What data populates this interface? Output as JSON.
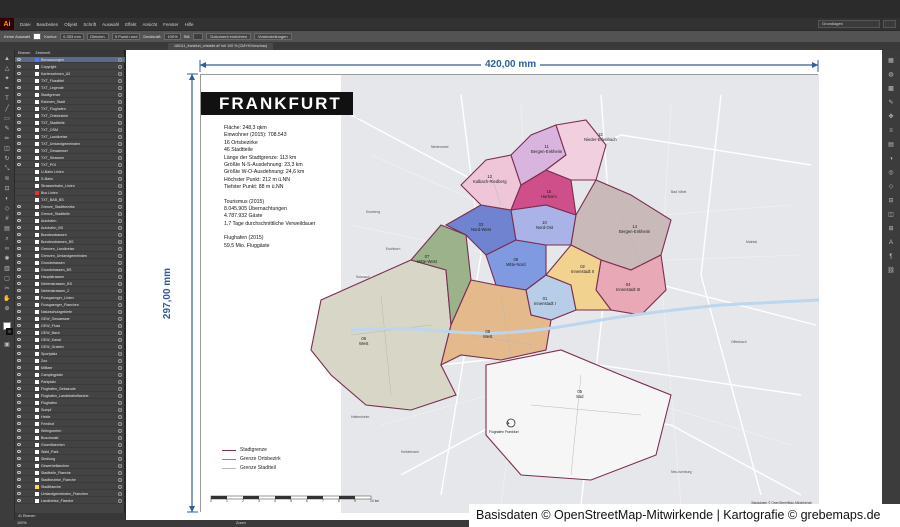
{
  "app": {
    "logo": "Ai"
  },
  "menu": [
    "Datei",
    "Bearbeiten",
    "Objekt",
    "Schrift",
    "Auswahl",
    "Effekt",
    "Ansicht",
    "Fenster",
    "Hilfe"
  ],
  "workspace": "Grundlagen",
  "controlbar": {
    "selection": "Keine Auswahl",
    "stroke_label": "Kontur:",
    "stroke_value": "0,353 mm",
    "profile": "Gleichm.",
    "brush": "5 Punkt rund",
    "opacity_label": "Deckkraft:",
    "opacity_value": "100%",
    "style_label": "Stil:",
    "doc_setup": "Dokument einrichten",
    "preferences": "Voreinstellungen"
  },
  "doc_tab": "180111_frankfurt_ortsteile.ai* bei 100 % (CMYK/Vorschau)",
  "layers": {
    "tabs": [
      "Ebenen",
      "Zeichenfl."
    ],
    "footer": "41 Ebenen",
    "rows": [
      {
        "name": "Bemassungen",
        "color": "#4f7cff",
        "eye": true,
        "selected": true
      },
      {
        "name": "Copyright",
        "color": "#ffffff",
        "eye": true
      },
      {
        "name": "Kartenrahmen_A3",
        "color": "#ffffff",
        "eye": true
      },
      {
        "name": "TXT_Flusstitel",
        "color": "#ffffff",
        "eye": true
      },
      {
        "name": "TXT_Legende",
        "color": "#ffffff",
        "eye": true
      },
      {
        "name": "Stadtgrenze",
        "color": "#ffffff",
        "eye": true
      },
      {
        "name": "Rahmen_Stadt",
        "color": "#ffffff",
        "eye": true
      },
      {
        "name": "TXT_Flughafen",
        "color": "#ffffff",
        "eye": true
      },
      {
        "name": "TXT_Ortsbezirke",
        "color": "#ffffff",
        "eye": true
      },
      {
        "name": "TXT_Stadtteile",
        "color": "#ffffff",
        "eye": true
      },
      {
        "name": "TXT_OSM",
        "color": "#ffffff",
        "eye": true
      },
      {
        "name": "TXT_Landkreise",
        "color": "#ffffff",
        "eye": true
      },
      {
        "name": "TXT_Umlandgemeinden",
        "color": "#ffffff",
        "eye": true
      },
      {
        "name": "TXT_Gewaesser",
        "color": "#ffffff",
        "eye": true
      },
      {
        "name": "TXT_Strassen",
        "color": "#ffffff",
        "eye": true
      },
      {
        "name": "TXT_POI",
        "color": "#ffffff",
        "eye": true
      },
      {
        "name": "U-Bahn Linien",
        "color": "#ffffff",
        "eye": false
      },
      {
        "name": "S-Bahn",
        "color": "#ffffff",
        "eye": false
      },
      {
        "name": "Strassenbahn_Linien",
        "color": "#ffffff",
        "eye": false
      },
      {
        "name": "Bus Linien",
        "color": "#e8342b",
        "eye": false
      },
      {
        "name": "TXT_BAB_BS",
        "color": "#ffffff",
        "eye": false
      },
      {
        "name": "Grenze_Stadtbezirke",
        "color": "#ffffff",
        "eye": true
      },
      {
        "name": "Grenze_Stadtteile",
        "color": "#ffffff",
        "eye": true
      },
      {
        "name": "Autobahn",
        "color": "#ffffff",
        "eye": true
      },
      {
        "name": "Autobahn_BS",
        "color": "#ffffff",
        "eye": true
      },
      {
        "name": "Bundesstrassen",
        "color": "#ffffff",
        "eye": true
      },
      {
        "name": "Bundesstrassen_BS",
        "color": "#ffffff",
        "eye": true
      },
      {
        "name": "Grenzen_Landkreise",
        "color": "#ffffff",
        "eye": true
      },
      {
        "name": "Grenzen_Umlandgemeinden",
        "color": "#ffffff",
        "eye": true
      },
      {
        "name": "Grundstrassen",
        "color": "#ffffff",
        "eye": true
      },
      {
        "name": "Grundstrassen_BS",
        "color": "#ffffff",
        "eye": true
      },
      {
        "name": "Hauptstrassen",
        "color": "#ffffff",
        "eye": true
      },
      {
        "name": "Nebenstrassen_BS",
        "color": "#ffffff",
        "eye": true
      },
      {
        "name": "Nebenstrassen_2",
        "color": "#ffffff",
        "eye": true
      },
      {
        "name": "Fussgaenger_Linien",
        "color": "#ffffff",
        "eye": true
      },
      {
        "name": "Fussgaenger_Flaechen",
        "color": "#ffffff",
        "eye": true
      },
      {
        "name": "Naturschutzgebiete",
        "color": "#ffffff",
        "eye": true
      },
      {
        "name": "GEW_Gewaesser",
        "color": "#ffffff",
        "eye": true
      },
      {
        "name": "GEW_Fluss",
        "color": "#ffffff",
        "eye": true
      },
      {
        "name": "GEW_Bach",
        "color": "#ffffff",
        "eye": true
      },
      {
        "name": "GEW_Kanal",
        "color": "#ffffff",
        "eye": true
      },
      {
        "name": "GEW_Graben",
        "color": "#ffffff",
        "eye": true
      },
      {
        "name": "Sportplatz",
        "color": "#ffffff",
        "eye": true
      },
      {
        "name": "Zoo",
        "color": "#ffffff",
        "eye": true
      },
      {
        "name": "Militaer",
        "color": "#ffffff",
        "eye": true
      },
      {
        "name": "Campingplatz",
        "color": "#ffffff",
        "eye": true
      },
      {
        "name": "Parkplatz",
        "color": "#ffffff",
        "eye": true
      },
      {
        "name": "Flughafen_Gebaeude",
        "color": "#ffffff",
        "eye": true
      },
      {
        "name": "Flughafen_Landebahnflaeche",
        "color": "#ffffff",
        "eye": true
      },
      {
        "name": "Flughafen",
        "color": "#ffffff",
        "eye": true
      },
      {
        "name": "Sumpf",
        "color": "#ffffff",
        "eye": true
      },
      {
        "name": "Heide",
        "color": "#ffffff",
        "eye": true
      },
      {
        "name": "Friedhof",
        "color": "#ffffff",
        "eye": true
      },
      {
        "name": "Weinguerten",
        "color": "#ffffff",
        "eye": true
      },
      {
        "name": "Buschwald",
        "color": "#ffffff",
        "eye": true
      },
      {
        "name": "Gruenflaechen",
        "color": "#ffffff",
        "eye": true
      },
      {
        "name": "Wald_Park",
        "color": "#ffffff",
        "eye": true
      },
      {
        "name": "Siedlung",
        "color": "#ffffff",
        "eye": true
      },
      {
        "name": "Gewerbeflaechen",
        "color": "#ffffff",
        "eye": true
      },
      {
        "name": "Stadtteile_Flaeche",
        "color": "#ffffff",
        "eye": true
      },
      {
        "name": "Stadtbezirke_Flaeche",
        "color": "#ffffff",
        "eye": true
      },
      {
        "name": "Stadtflaeche",
        "color": "#ffd84f",
        "eye": true
      },
      {
        "name": "Umlandgemeinden_Flaechen",
        "color": "#ffffff",
        "eye": true
      },
      {
        "name": "Landkreise_Flaeche",
        "color": "#ffffff",
        "eye": true
      }
    ]
  },
  "map": {
    "title": "FRANKFURT",
    "width_label": "420,00 mm",
    "height_label": "297,00 mm",
    "stats": [
      "Fläche: 248,3 qkm",
      "Einwohner (2015): 708.543",
      "16 Ortsbezirke",
      "46 Stadtteile",
      "Länge der Stadtgrenze: 113 km",
      "Größte N-S-Ausdehnung: 23,3 km",
      "Größte W-O-Ausdehnung: 24,6 km",
      "Höchster Punkt: 212 m ü.NN",
      "Tiefster Punkt: 88 m ü.NN",
      "",
      "Tourismus (2015)",
      "8.045.905 Übernachtungen",
      "4.787.932 Gäste",
      "1,7 Tage durchschnittliche Verweildauer",
      "",
      "Flughafen (2015)",
      "59,5 Mio. Fluggäste"
    ],
    "districts": [
      {
        "label": "13\nNieder-Erlenbach",
        "color": "#f1cfdf"
      },
      {
        "label": "12\nKalbach-Riedberg",
        "color": "#efc6d8"
      },
      {
        "label": "11\nBergen-Enkheim",
        "color": "#d9b4de"
      },
      {
        "label": "15\nHarheim",
        "color": "#cf4f8a"
      },
      {
        "label": "10\nNord-Ost",
        "color": "#a9b3e8"
      },
      {
        "label": "09\nMitte-Nord",
        "color": "#7f9ae0"
      },
      {
        "label": "03\nNord-West",
        "color": "#6f83d0"
      },
      {
        "label": "01\nInnenstadt I",
        "color": "#b8cde8"
      },
      {
        "label": "14\nBergen-Enkheim",
        "color": "#c9b9b9"
      },
      {
        "label": "04\nInnenstadt III",
        "color": "#e8a8b5"
      },
      {
        "label": "02\nInnenstadt II",
        "color": "#f1d28f"
      },
      {
        "label": "06\nWest",
        "color": "#d8d6c6"
      },
      {
        "label": "07\nMitte-West",
        "color": "#9bb28a"
      },
      {
        "label": "05\nSüd",
        "color": "#f6f6f6"
      },
      {
        "label": "08\nWest",
        "color": "#e4b98b"
      }
    ],
    "streets": [
      "Niederursel",
      "Kronberg",
      "Eschborn",
      "Sulzbach",
      "Bad Vilbel",
      "Maintal",
      "Offenbach",
      "Neu-Isenburg",
      "Kelsterbach",
      "Hattersheim",
      "Flughafen Frankfurt"
    ],
    "legend": [
      {
        "label": "Stadtgrenze",
        "color": "#7a2e52"
      },
      {
        "label": "Grenze Ortsbezirk",
        "color": "#c76a8e"
      },
      {
        "label": "Grenze Stadtteil",
        "color": "#b8b8b8"
      }
    ],
    "scale_ticks": [
      "0",
      "1",
      "2",
      "3",
      "4",
      "5",
      "6",
      "7",
      "8",
      "9",
      "10 km"
    ],
    "credits": "Basisdaten © OpenStreetMap-Mitwirkende"
  },
  "status": {
    "zoom": "100%",
    "text": "Zoom"
  },
  "caption": "Basisdaten © OpenStreetMap-Mitwirkende | Kartografie © grebemaps.de"
}
